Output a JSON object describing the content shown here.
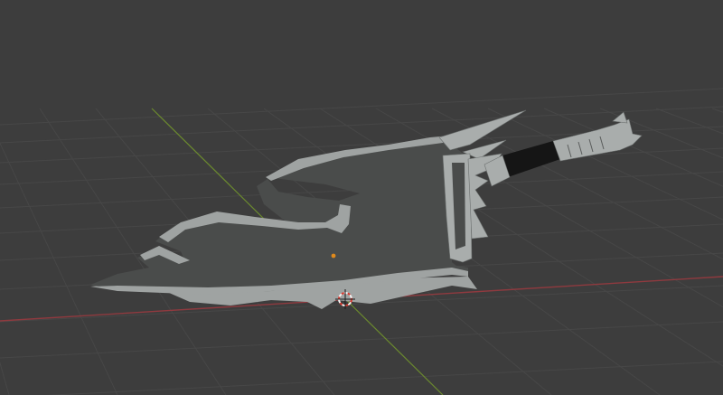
{
  "app": {
    "kind": "3d-viewport"
  },
  "viewport": {
    "background_color": "#3d3d3d",
    "grid_color": "#474747",
    "x_axis_color": "#8f3a3f",
    "y_axis_color": "#6b8a2e",
    "show_grid": true
  },
  "scene": {
    "object": {
      "icon": "mesh-object-icon",
      "shape": "axe-blade-with-handle",
      "body_color": "#4a4c4b",
      "rim_color": "#9fa3a2",
      "handle_wrap_color": "#151515",
      "metal_color": "#a9adac"
    },
    "origin_dot_color": "#e08a1c",
    "cursor_icon": "3d-cursor-icon",
    "cursor_colors": [
      "#d8392f",
      "#f4f4f4"
    ]
  }
}
